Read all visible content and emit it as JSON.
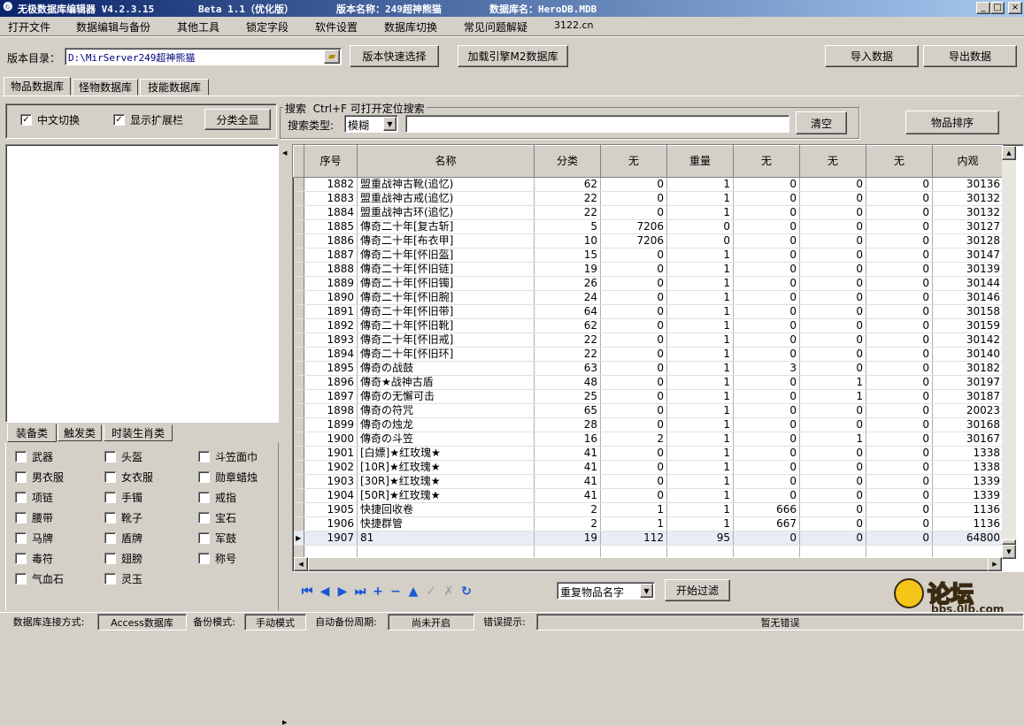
{
  "titlebar": {
    "app_title": "无极数据库编辑器 V4.2.3.15",
    "beta": "Beta 1.1（优化版）",
    "version_name": "版本名称：249超神熊猫",
    "db_name": "数据库名：HeroDB.MDB",
    "min": "_",
    "max": "□",
    "close": "×"
  },
  "menu": [
    "打开文件",
    "数据编辑与备份",
    "其他工具",
    "锁定字段",
    "软件设置",
    "数据库切换",
    "常见问题解疑",
    "3122.cn"
  ],
  "toolbar": {
    "dir_label": "版本目录：",
    "dir_value": "D:\\MirServer249超神熊猫",
    "quick_select": "版本快速选择",
    "load_m2": "加载引擎M2数据库",
    "import": "导入数据",
    "export": "导出数据"
  },
  "tabs": [
    "物品数据库",
    "怪物数据库",
    "技能数据库"
  ],
  "options": {
    "cn_switch": "中文切换",
    "show_ext": "显示扩展栏",
    "show_all": "分类全显"
  },
  "search": {
    "group_title": "搜索  Ctrl+F 可打开定位搜索",
    "type_label": "搜索类型:",
    "type_value": "模糊",
    "query": "",
    "clear": "清空",
    "sort": "物品排序"
  },
  "cat_tabs": [
    "装备类",
    "触发类",
    "时装生肖类"
  ],
  "categories": [
    "武器",
    "头盔",
    "斗笠面巾",
    "男衣服",
    "女衣服",
    "勋章蜡烛",
    "项链",
    "手镯",
    "戒指",
    "腰带",
    "靴子",
    "宝石",
    "马牌",
    "盾牌",
    "军鼓",
    "毒符",
    "翅膀",
    "称号",
    "气血石",
    "灵玉"
  ],
  "grid": {
    "columns": [
      "序号",
      "名称",
      "分类",
      "无",
      "重量",
      "无",
      "无",
      "无",
      "内观"
    ],
    "rows": [
      [
        "1882",
        "盟重战神古靴(追忆)",
        "62",
        "0",
        "1",
        "0",
        "0",
        "0",
        "30136"
      ],
      [
        "1883",
        "盟重战神古戒(追忆)",
        "22",
        "0",
        "1",
        "0",
        "0",
        "0",
        "30132"
      ],
      [
        "1884",
        "盟重战神古环(追忆)",
        "22",
        "0",
        "1",
        "0",
        "0",
        "0",
        "30132"
      ],
      [
        "1885",
        "傳奇二十年[复古斩]",
        "5",
        "7206",
        "0",
        "0",
        "0",
        "0",
        "30127"
      ],
      [
        "1886",
        "傳奇二十年[布衣甲]",
        "10",
        "7206",
        "0",
        "0",
        "0",
        "0",
        "30128"
      ],
      [
        "1887",
        "傳奇二十年[怀旧盔]",
        "15",
        "0",
        "1",
        "0",
        "0",
        "0",
        "30147"
      ],
      [
        "1888",
        "傳奇二十年[怀旧链]",
        "19",
        "0",
        "1",
        "0",
        "0",
        "0",
        "30139"
      ],
      [
        "1889",
        "傳奇二十年[怀旧镯]",
        "26",
        "0",
        "1",
        "0",
        "0",
        "0",
        "30144"
      ],
      [
        "1890",
        "傳奇二十年[怀旧腕]",
        "24",
        "0",
        "1",
        "0",
        "0",
        "0",
        "30146"
      ],
      [
        "1891",
        "傳奇二十年[怀旧带]",
        "64",
        "0",
        "1",
        "0",
        "0",
        "0",
        "30158"
      ],
      [
        "1892",
        "傳奇二十年[怀旧靴]",
        "62",
        "0",
        "1",
        "0",
        "0",
        "0",
        "30159"
      ],
      [
        "1893",
        "傳奇二十年[怀旧戒]",
        "22",
        "0",
        "1",
        "0",
        "0",
        "0",
        "30142"
      ],
      [
        "1894",
        "傳奇二十年[怀旧环]",
        "22",
        "0",
        "1",
        "0",
        "0",
        "0",
        "30140"
      ],
      [
        "1895",
        "傳奇の战鼓",
        "63",
        "0",
        "1",
        "3",
        "0",
        "0",
        "30182"
      ],
      [
        "1896",
        "傳奇★战神古盾",
        "48",
        "0",
        "1",
        "0",
        "1",
        "0",
        "30197"
      ],
      [
        "1897",
        "傳奇の无懈可击",
        "25",
        "0",
        "1",
        "0",
        "1",
        "0",
        "30187"
      ],
      [
        "1898",
        "傳奇の符咒",
        "65",
        "0",
        "1",
        "0",
        "0",
        "0",
        "20023"
      ],
      [
        "1899",
        "傳奇の烛龙",
        "28",
        "0",
        "1",
        "0",
        "0",
        "0",
        "30168"
      ],
      [
        "1900",
        "傳奇の斗笠",
        "16",
        "2",
        "1",
        "0",
        "1",
        "0",
        "30167"
      ],
      [
        "1901",
        "[白嫖]★红玫瑰★",
        "41",
        "0",
        "1",
        "0",
        "0",
        "0",
        "1338"
      ],
      [
        "1902",
        "[10R]★红玫瑰★",
        "41",
        "0",
        "1",
        "0",
        "0",
        "0",
        "1338"
      ],
      [
        "1903",
        "[30R]★红玫瑰★",
        "41",
        "0",
        "1",
        "0",
        "0",
        "0",
        "1339"
      ],
      [
        "1904",
        "[50R]★红玫瑰★",
        "41",
        "0",
        "1",
        "0",
        "0",
        "0",
        "1339"
      ],
      [
        "1905",
        "快捷回收卷",
        "2",
        "1",
        "1",
        "666",
        "0",
        "0",
        "1136"
      ],
      [
        "1906",
        "快捷群管",
        "2",
        "1",
        "1",
        "667",
        "0",
        "0",
        "1136"
      ],
      [
        "1907",
        "81",
        "19",
        "112",
        "95",
        "0",
        "0",
        "0",
        "64800"
      ]
    ],
    "selected_row": 25
  },
  "bottom": {
    "filter_value": "重复物品名字",
    "start_filter": "开始过滤"
  },
  "statusbar": {
    "conn_label": "数据库连接方式:",
    "conn_value": "Access数据库",
    "backup_label": "备份模式:",
    "backup_value": "手动模式",
    "auto_label": "自动备份周期:",
    "auto_value": "尚未开启",
    "err_label": "错误提示:",
    "err_value": "暂无错误"
  },
  "watermark": {
    "text": "论坛",
    "url": "bbs.0lb.com"
  }
}
